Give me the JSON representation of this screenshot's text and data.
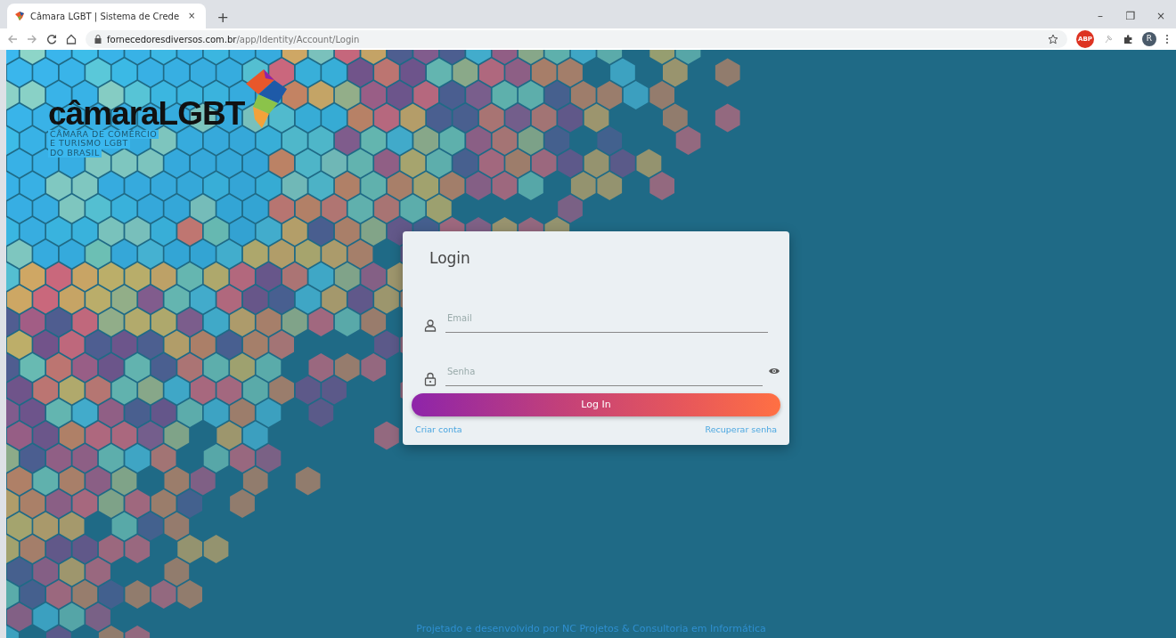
{
  "browser": {
    "tab_title": "Câmara LGBT | Sistema de Crede",
    "tab_close": "×",
    "new_tab": "+",
    "url_host": "fornecedoresdiversos.com.br",
    "url_path": "/app/Identity/Account/Login",
    "profile_initial": "R",
    "adblock_label": "ABP",
    "window_controls": [
      "–",
      "❐",
      "×"
    ]
  },
  "logo": {
    "wordmark": "câmaraLGBT",
    "subtitle_lines": [
      "CÂMARA DE COMÉRCIO",
      "E TURISMO LGBT",
      "DO BRASIL"
    ]
  },
  "login": {
    "title": "Login",
    "fields": [
      {
        "kind": "email",
        "placeholder": "Email"
      },
      {
        "kind": "password",
        "placeholder": "Senha"
      }
    ],
    "submit": "Log In",
    "links": [
      "Criar conta",
      "Recuperar senha"
    ]
  },
  "footer": "Projetado e desenvolvido por NC Projetos & Consultoria em Informática"
}
